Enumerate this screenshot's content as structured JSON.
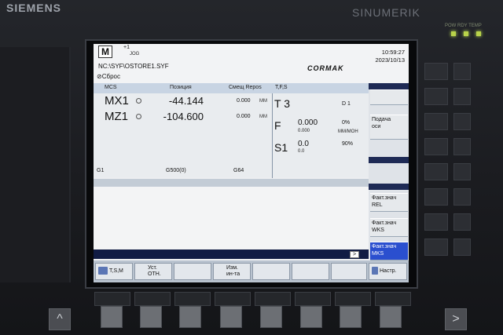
{
  "bezel": {
    "brand_left": "SIEMENS",
    "brand_right": "SINUMERIK",
    "leds": "POW  RDY  TEMP"
  },
  "header": {
    "mode_icon": "M",
    "rapid_override": "+1",
    "mode": "JOG",
    "program_path": "NC:\\SYF\\OSTORE1.SYF",
    "reset_label": "Сброс",
    "brand": "CORMAK",
    "time": "10:59:27",
    "date": "2023/10/13"
  },
  "position": {
    "cs_label": "MCS",
    "col_position": "Позиция",
    "col_offset": "Смещ Repos",
    "axes": [
      {
        "name": "MX1",
        "value": "-44.144",
        "offset": "0.000",
        "unit": "MM"
      },
      {
        "name": "MZ1",
        "value": "-104.600",
        "offset": "0.000",
        "unit": "MM"
      }
    ],
    "gcodes": [
      "G1",
      "G500(0)",
      "G64"
    ]
  },
  "tfs": {
    "title": "T,F,S",
    "tool_label": "T 3",
    "d_label": "D 1",
    "feed_label": "F",
    "feed_value": "0.000",
    "feed_actual": "0.000",
    "feed_percent": "0%",
    "feed_unit": "MM/MOH",
    "spindle_label": "S1",
    "spindle_value": "0.0",
    "spindle_actual": "0.0",
    "spindle_percent": "90%"
  },
  "softkeys_vertical": [
    {
      "label": "Подача\nоси"
    },
    {
      "label": "Факт.знач\nREL"
    },
    {
      "label": "Факт.знач\nWKS"
    },
    {
      "label": "Факт.знач\nMKS"
    },
    {
      "label": "Настр."
    }
  ],
  "softkeys_horizontal": [
    {
      "label": "T,S,M"
    },
    {
      "label": "Уст.\nОТН."
    },
    {
      "label": "Изм.\nин-та"
    }
  ],
  "next_arrow": ">",
  "nav": {
    "up": "^",
    "right": ">"
  },
  "colors": {
    "selected_softkey": "#2a4fcf",
    "bar": "#111c44",
    "screen_bg": "#eceef0"
  }
}
